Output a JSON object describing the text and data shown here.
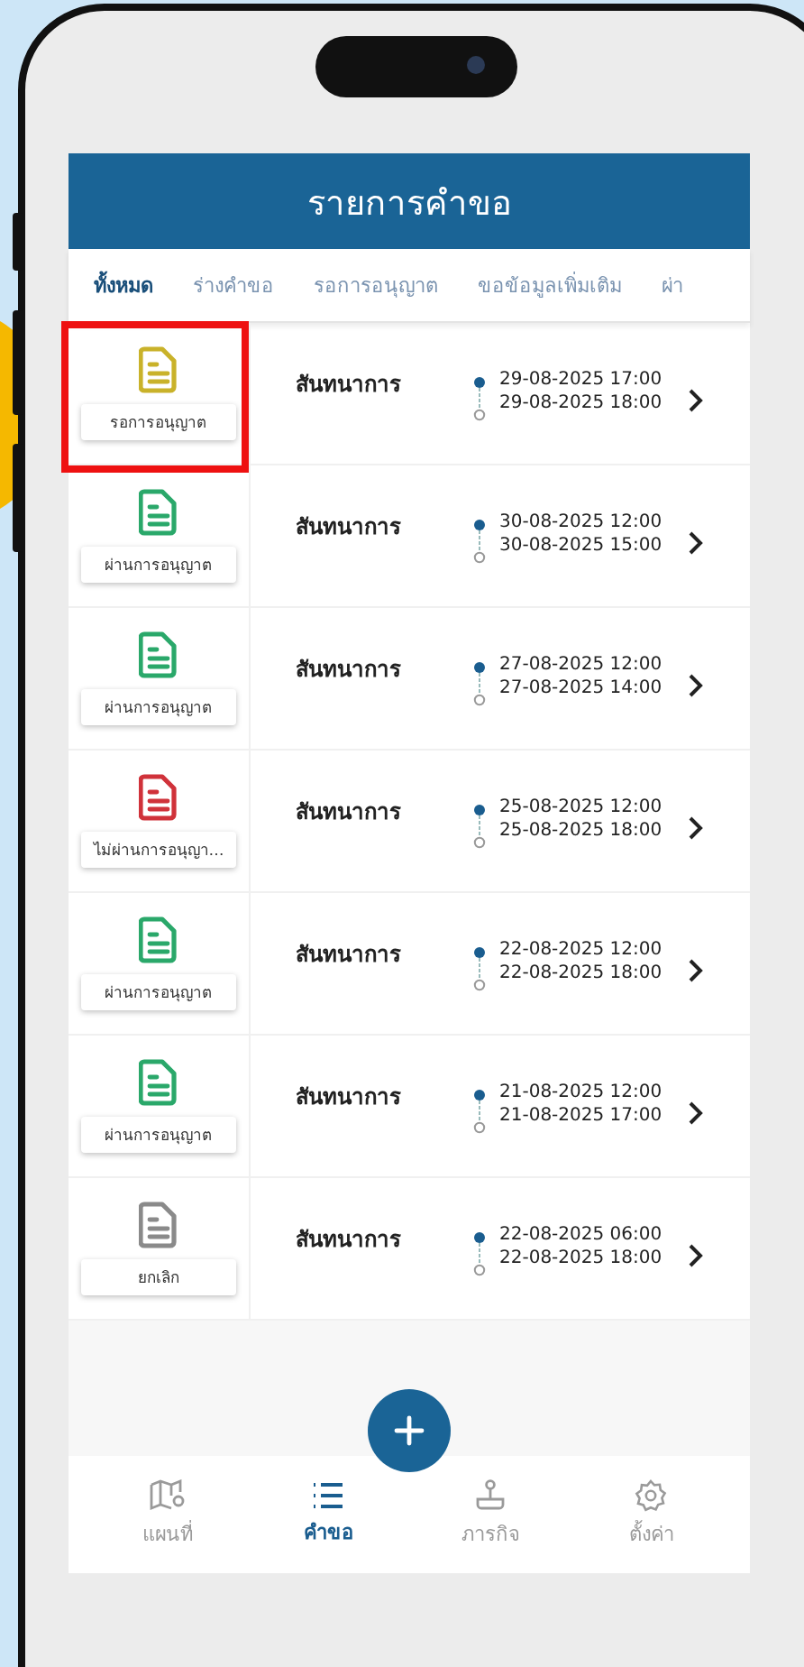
{
  "header": {
    "title": "รายการคำขอ"
  },
  "tabs": [
    {
      "label": "ทั้งหมด",
      "selected": true
    },
    {
      "label": "ร่างคำขอ",
      "selected": false
    },
    {
      "label": "รอการอนุญาต",
      "selected": false
    },
    {
      "label": "ขอข้อมูลเพิ่มเติม",
      "selected": false
    },
    {
      "label": "ผ่า",
      "selected": false
    }
  ],
  "requests": [
    {
      "status": "รอการอนุญาต",
      "color": "#c9b22a",
      "highlighted": true,
      "title": "สันทนาการ",
      "start": "29-08-2025 17:00",
      "end": "29-08-2025 18:00"
    },
    {
      "status": "ผ่านการอนุญาต",
      "color": "#2aa86a",
      "highlighted": false,
      "title": "สันทนาการ",
      "start": "30-08-2025 12:00",
      "end": "30-08-2025 15:00"
    },
    {
      "status": "ผ่านการอนุญาต",
      "color": "#2aa86a",
      "highlighted": false,
      "title": "สันทนาการ",
      "start": "27-08-2025 12:00",
      "end": "27-08-2025 14:00"
    },
    {
      "status": "ไม่ผ่านการอนุญา…",
      "color": "#d0323a",
      "highlighted": false,
      "title": "สันทนาการ",
      "start": "25-08-2025 12:00",
      "end": "25-08-2025 18:00"
    },
    {
      "status": "ผ่านการอนุญาต",
      "color": "#2aa86a",
      "highlighted": false,
      "title": "สันทนาการ",
      "start": "22-08-2025 12:00",
      "end": "22-08-2025 18:00"
    },
    {
      "status": "ผ่านการอนุญาต",
      "color": "#2aa86a",
      "highlighted": false,
      "title": "สันทนาการ",
      "start": "21-08-2025 12:00",
      "end": "21-08-2025 17:00"
    },
    {
      "status": "ยกเลิก",
      "color": "#8a8a8a",
      "highlighted": false,
      "title": "สันทนาการ",
      "start": "22-08-2025 06:00",
      "end": "22-08-2025 18:00"
    }
  ],
  "bottom_nav": [
    {
      "kind": "map",
      "label": "แผนที่",
      "selected": false
    },
    {
      "kind": "list",
      "label": "คำขอ",
      "selected": true
    },
    {
      "kind": "joystick",
      "label": "ภารกิจ",
      "selected": false
    },
    {
      "kind": "settings",
      "label": "ตั้งค่า",
      "selected": false
    }
  ]
}
